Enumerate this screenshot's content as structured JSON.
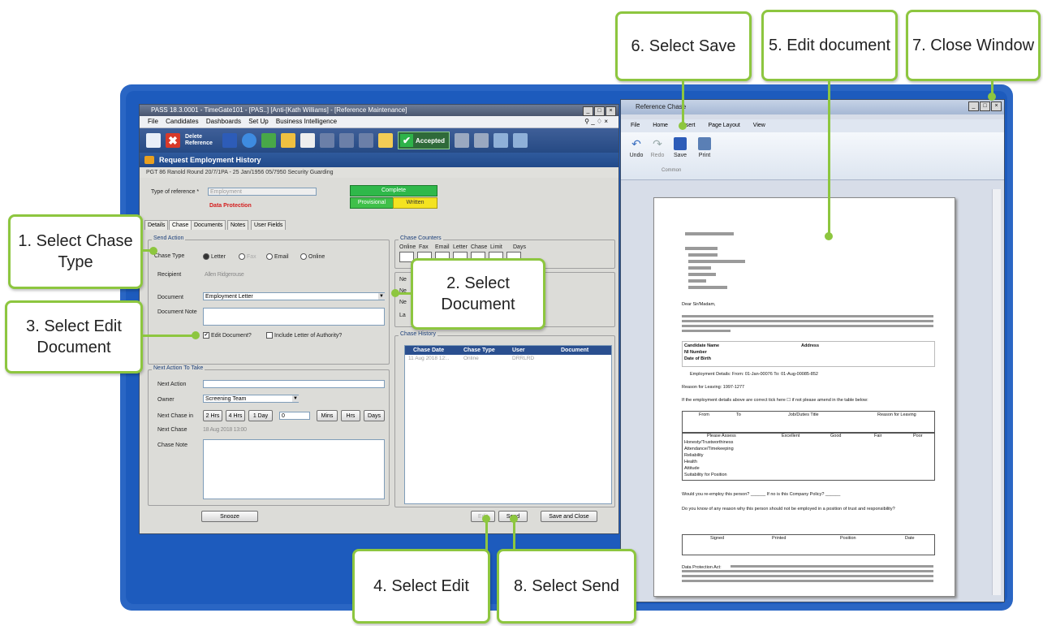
{
  "left_window": {
    "title": "PASS 18.3.0001 - TimeGate101 - [PAS..] [Anti-[Kath Williams] - [Reference Maintenance]",
    "menu": [
      "File",
      "Candidates",
      "Dashboards",
      "Set Up",
      "Business Intelligence"
    ],
    "toolbar": {
      "delete_label": "Delete Reference",
      "accepted_label": "Accepted"
    },
    "header_title": "Request Employment History",
    "ref_line": "PGT 86 Ranold Round 20/7/1PA - 25 Jan/1956 05/7950 Security Guarding",
    "type_of_reference_label": "Type of reference *",
    "type_of_reference_value": "Employment",
    "data_protection": "Data Protection",
    "status": {
      "complete": "Complete",
      "provisional": "Provisional",
      "written": "Written"
    },
    "tabs": [
      "Details",
      "Chase",
      "Documents",
      "Notes",
      "User Fields"
    ],
    "send_action": {
      "title": "Send Action",
      "chase_type_label": "Chase Type",
      "options": [
        "Letter",
        "Fax",
        "Email",
        "Online"
      ],
      "recipient_label": "Recipient",
      "recipient_value": "Allen Ridgerouse",
      "document_label": "Document",
      "document_value": "Employment Letter",
      "document_note_label": "Document Note",
      "edit_document_label": "Edit Document?",
      "include_letter_label": "Include Letter of Authority?"
    },
    "chase_counters": {
      "title": "Chase Counters",
      "columns": [
        "Online",
        "Fax",
        "Email",
        "Letter",
        "Chase",
        "Limit",
        "Days"
      ]
    },
    "next_partial": [
      "Ne",
      "Ne",
      "Ne",
      "La"
    ],
    "chase_history": {
      "title": "Chase History",
      "columns": [
        "Chase Date",
        "Chase Type",
        "User",
        "Document"
      ],
      "row": [
        "11 Aug 2018 12:..",
        "Online",
        "DRRLRD",
        ""
      ]
    },
    "next_action": {
      "title": "Next Action To Take",
      "next_action_label": "Next Action",
      "owner_label": "Owner",
      "owner_value": "Screening Team",
      "next_chase_in_label": "Next Chase in",
      "buttons": [
        "2 Hrs",
        "4 Hrs",
        "1 Day"
      ],
      "spin_value": "0",
      "unit_buttons": [
        "Mins",
        "Hrs",
        "Days"
      ],
      "next_chase_label": "Next Chase",
      "next_chase_value": "18 Aug 2018 13:00",
      "chase_note_label": "Chase Note"
    },
    "footer": {
      "snooze": "Snooze",
      "edit": "Edit",
      "send": "Send",
      "save_close": "Save and Close"
    }
  },
  "right_window": {
    "title": "Reference Chase",
    "ribbon_tabs": [
      "File",
      "Home",
      "Insert",
      "Page Layout",
      "View"
    ],
    "ribbon_buttons": [
      "Undo",
      "Redo",
      "Save",
      "Print"
    ],
    "ribbon_group": "Common",
    "doc": {
      "salutation": "Dear Sir/Madam,",
      "table_headers": [
        "Candidate Name",
        "NI Number",
        "Date of Birth",
        "Address"
      ],
      "employment_dates": "Employment Details: From: 01-Jan-00076 To: 01-Aug-00085-852",
      "reason": "Reason for Leaving: 1997-1277",
      "correct_line": "If the employment details above are correct tick here ☐ if not please amend in the table below:",
      "emp_table_headers": [
        "From",
        "To",
        "Job/Duties Title",
        "Reason for Leaving"
      ],
      "assess_headers": [
        "Please Assess",
        "Excellent",
        "Good",
        "Fair",
        "Poor"
      ],
      "assess_rows": [
        "Honesty/Trustworthiness",
        "Attendance/Timekeeping",
        "Reliability",
        "Health",
        "Attitude",
        "Suitability for Position"
      ],
      "reemploy": "Would you re-employ this person? ______ If no is this Company Policy? ______",
      "know_reason": "Do you know of any reason why this person should not be employed in a position of trust and responsibility?",
      "sign_headers": [
        "Signed",
        "Printed",
        "Position",
        "Date"
      ],
      "dp_heading": "Data Protection Act:"
    }
  },
  "callouts": {
    "c1": "1. Select Chase Type",
    "c2": "2. Select Document",
    "c3": "3. Select Edit Document",
    "c4": "4. Select Edit",
    "c5": "5. Edit document",
    "c6": "6. Select Save",
    "c7": "7. Close Window",
    "c8": "8. Select Send"
  },
  "colors": {
    "callout_border": "#8dc63f",
    "backdrop": "#2a66c4",
    "toolbar": "#264a84"
  }
}
